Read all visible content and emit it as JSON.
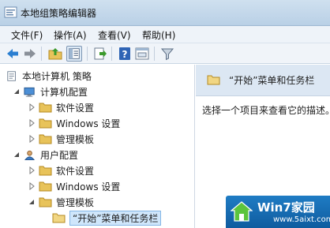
{
  "window": {
    "title": "本地组策略编辑器"
  },
  "menu": [
    "文件(F)",
    "操作(A)",
    "查看(V)",
    "帮助(H)"
  ],
  "toolbar": {
    "icons": [
      "back-icon",
      "forward-icon",
      "up-folder-icon",
      "show-hide-tree-icon",
      "export-list-icon",
      "help-icon",
      "properties-icon",
      "filter-icon"
    ]
  },
  "tree": {
    "root": "本地计算机 策略",
    "computer_config": "计算机配置",
    "software_settings_1": "软件设置",
    "windows_settings_1": "Windows 设置",
    "admin_templates_1": "管理模板",
    "user_config": "用户配置",
    "software_settings_2": "软件设置",
    "windows_settings_2": "Windows 设置",
    "admin_templates_2": "管理模板",
    "start_menu": "“开始”菜单和任务栏"
  },
  "details": {
    "header_title": "“开始”菜单和任务栏",
    "description": "选择一个项目来查看它的描述。"
  },
  "watermark": {
    "title": "Win7家园",
    "url": "www.5aixt.com"
  },
  "colors": {
    "folder": "#e8c35a",
    "accent": "#1f7cc4",
    "selection": "#cfe6fb"
  }
}
